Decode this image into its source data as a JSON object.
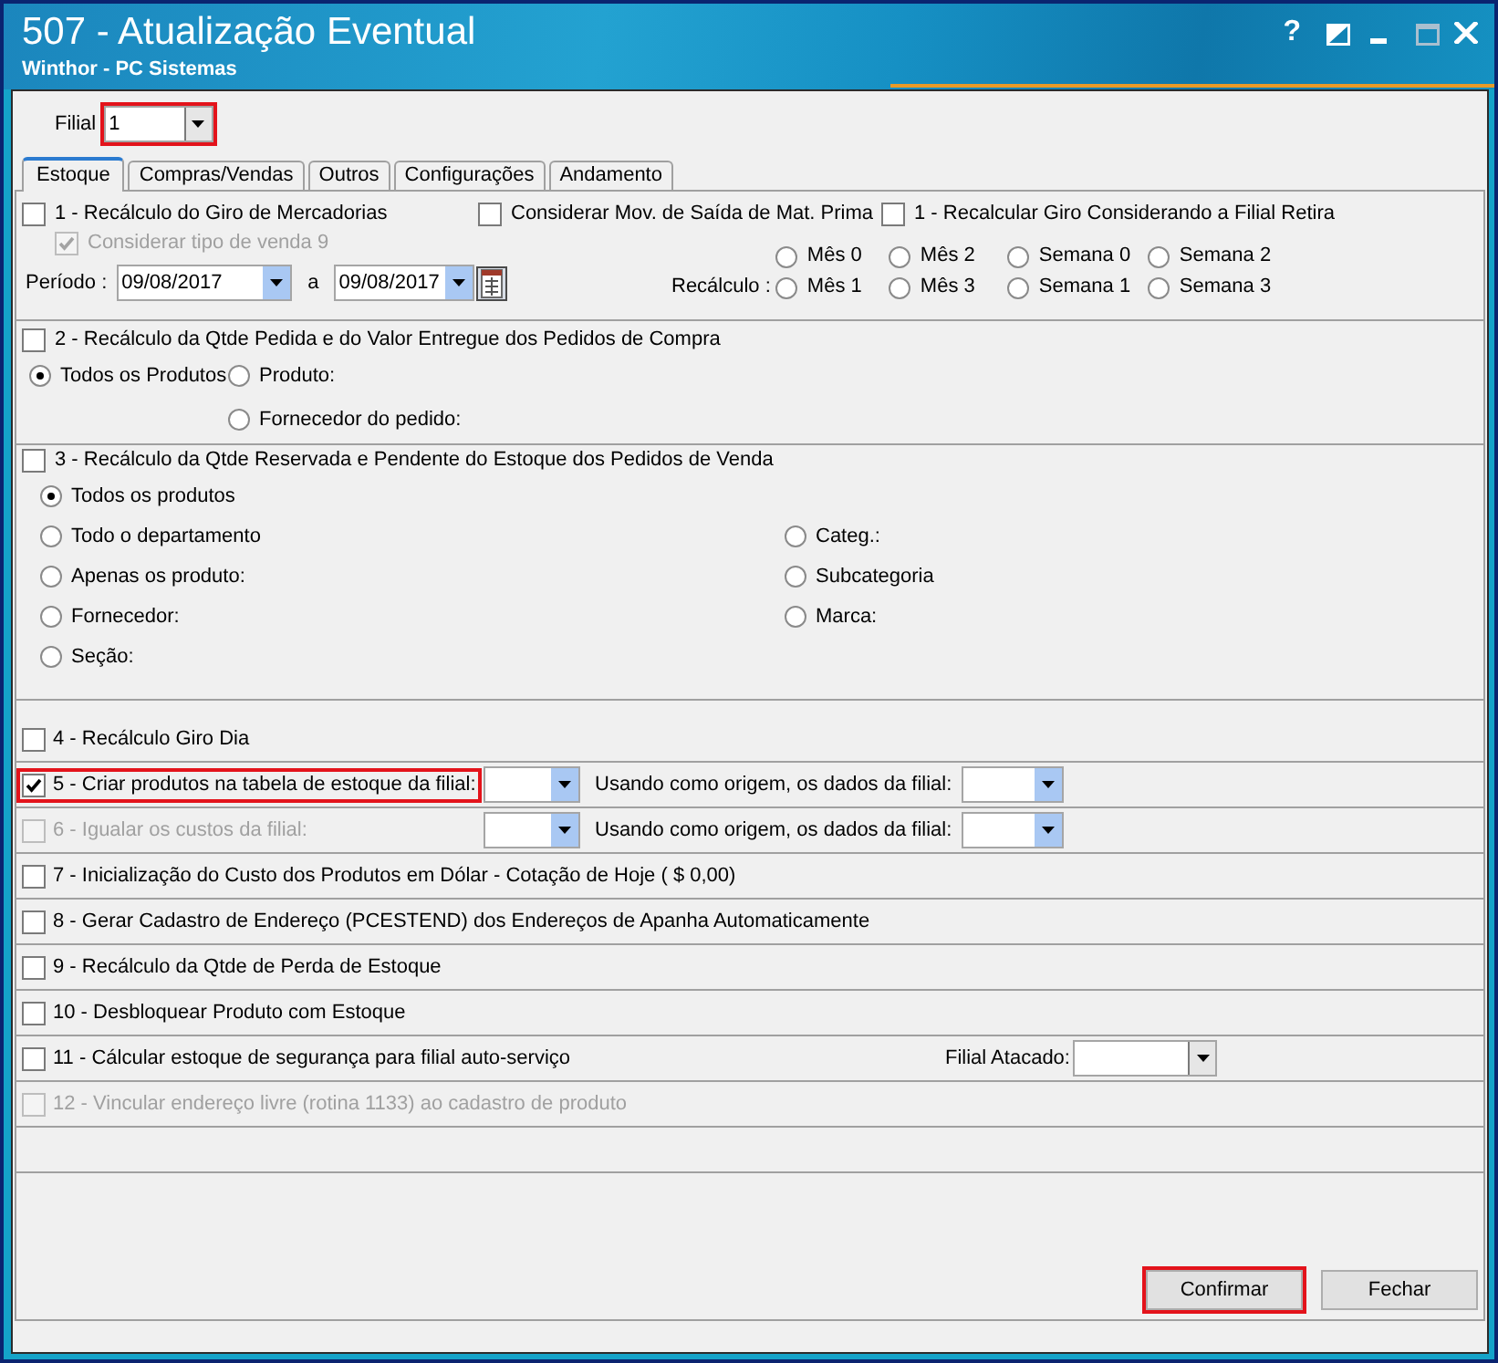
{
  "window": {
    "title": "507 - Atualização Eventual",
    "subtitle": "Winthor - PC Sistemas",
    "help": "?"
  },
  "filial": {
    "label": "Filial",
    "value": "1",
    "highlighted": true
  },
  "tabs": [
    {
      "label": "Estoque",
      "selected": true
    },
    {
      "label": "Compras/Vendas",
      "selected": false
    },
    {
      "label": "Outros",
      "selected": false
    },
    {
      "label": "Configurações",
      "selected": false
    },
    {
      "label": "Andamento",
      "selected": false
    }
  ],
  "giro": {
    "options": [
      {
        "label": "1 - Recálculo do Giro de Mercadorias",
        "checked": false
      },
      {
        "label": "Considerar Mov. de Saída de Mat. Prima",
        "checked": false
      },
      {
        "label": "1 - Recalcular Giro Considerando a Filial Retira",
        "checked": false
      }
    ],
    "venda_9": {
      "label": "Considerar tipo de venda 9",
      "checked": true,
      "disabled": true
    },
    "periodo": {
      "label": "Período :",
      "from": "09/08/2017",
      "between": "a",
      "to": "09/08/2017"
    },
    "recalculo": {
      "label": "Recálculo :",
      "options": [
        {
          "label": "Mês 0",
          "selected": false
        },
        {
          "label": "Mês 2",
          "selected": false
        },
        {
          "label": "Semana 0",
          "selected": false
        },
        {
          "label": "Semana 2",
          "selected": false
        },
        {
          "label": "Mês 1",
          "selected": false
        },
        {
          "label": "Mês 3",
          "selected": false
        },
        {
          "label": "Semana 1",
          "selected": false
        },
        {
          "label": "Semana 3",
          "selected": false
        }
      ]
    }
  },
  "pedidos_compra": {
    "label": "2 - Recálculo da Qtde Pedida e do Valor Entregue dos Pedidos de Compra",
    "checked": false,
    "options": [
      {
        "label": "Todos os Produtos",
        "selected": true
      },
      {
        "label": "Produto:",
        "selected": false
      },
      {
        "label": "Fornecedor do pedido:",
        "selected": false
      }
    ]
  },
  "pedidos_venda": {
    "label": "3 - Recálculo da Qtde Reservada e Pendente do Estoque dos Pedidos de Venda",
    "checked": false,
    "left_options": [
      {
        "label": "Todos os produtos",
        "selected": true
      },
      {
        "label": "Todo o departamento",
        "selected": false
      },
      {
        "label": "Apenas os produto:",
        "selected": false
      },
      {
        "label": "Fornecedor:",
        "selected": false
      },
      {
        "label": "Seção:",
        "selected": false
      }
    ],
    "right_options": [
      {
        "label": "Categ.:",
        "selected": false
      },
      {
        "label": "Subcategoria",
        "selected": false
      },
      {
        "label": "Marca:",
        "selected": false
      }
    ]
  },
  "rows": [
    {
      "kind": "plain",
      "label": "4 - Recálculo Giro Dia",
      "checked": false,
      "disabled": false,
      "highlighted": false
    },
    {
      "kind": "copy",
      "label": "5 - Criar produtos na tabela de estoque da filial:",
      "checked": true,
      "disabled": false,
      "highlighted": true,
      "origin_label": "Usando como origem, os dados da filial:"
    },
    {
      "kind": "copy",
      "label": "6 - Igualar os custos da filial:",
      "checked": false,
      "disabled": true,
      "highlighted": false,
      "origin_label": "Usando como origem, os dados da filial:"
    },
    {
      "kind": "plain",
      "label": "7 - Inicialização do Custo dos Produtos em Dólar - Cotação de Hoje ( $ 0,00)",
      "checked": false,
      "disabled": false,
      "highlighted": false
    },
    {
      "kind": "plain",
      "label": "8 - Gerar Cadastro de Endereço (PCESTEND) dos Endereços de Apanha Automaticamente",
      "checked": false,
      "disabled": false,
      "highlighted": false
    },
    {
      "kind": "plain",
      "label": "9 - Recálculo da Qtde de Perda de Estoque",
      "checked": false,
      "disabled": false,
      "highlighted": false
    },
    {
      "kind": "plain",
      "label": "10 - Desbloquear Produto com Estoque",
      "checked": false,
      "disabled": false,
      "highlighted": false
    },
    {
      "kind": "atacado",
      "label": "11 - Cálcular estoque de segurança para filial auto-serviço",
      "checked": false,
      "disabled": false,
      "highlighted": false,
      "extra_label": "Filial Atacado:"
    },
    {
      "kind": "plain",
      "label": "12 - Vincular endereço livre (rotina 1133) ao cadastro de produto",
      "checked": false,
      "disabled": true,
      "highlighted": false
    }
  ],
  "buttons": [
    {
      "label": "Confirmar",
      "highlighted": true
    },
    {
      "label": "Fechar",
      "highlighted": false
    }
  ]
}
